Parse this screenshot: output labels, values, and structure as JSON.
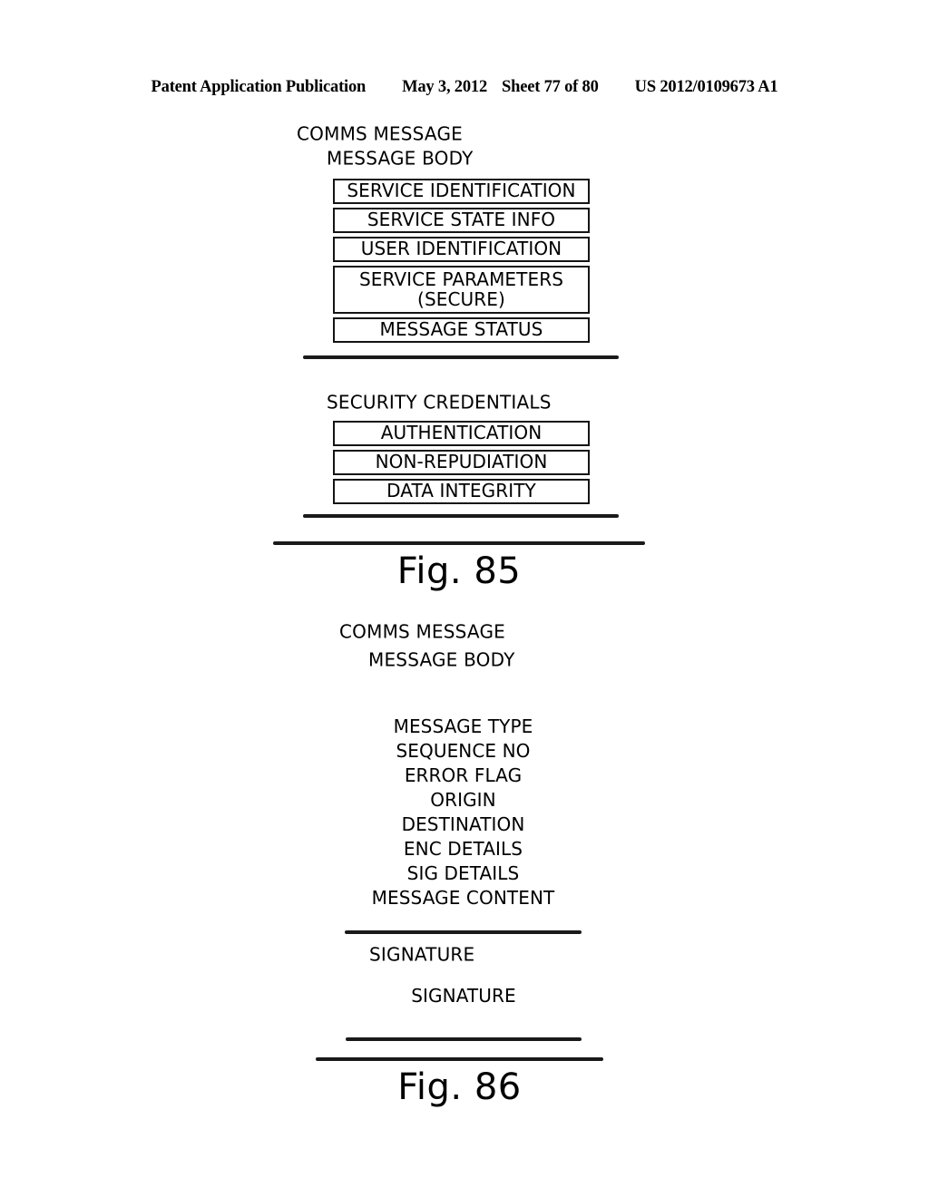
{
  "header": {
    "publication": "Patent Application Publication",
    "date": "May 3, 2012",
    "sheet": "Sheet 77 of 80",
    "doc_number": "US 2012/0109673 A1"
  },
  "figures": [
    {
      "caption": "Fig. 85",
      "outer_label": "COMMS MESSAGE",
      "groups": [
        {
          "label": "MESSAGE BODY",
          "style": "boxes",
          "items": [
            "SERVICE IDENTIFICATION",
            "SERVICE STATE INFO",
            "USER IDENTIFICATION",
            "SERVICE PARAMETERS\n(SECURE)",
            "MESSAGE STATUS"
          ]
        },
        {
          "label": "SECURITY CREDENTIALS",
          "style": "boxes",
          "items": [
            "AUTHENTICATION",
            "NON-REPUDIATION",
            "DATA INTEGRITY"
          ]
        }
      ]
    },
    {
      "caption": "Fig. 86",
      "outer_label": "COMMS MESSAGE",
      "groups": [
        {
          "label": "MESSAGE BODY",
          "style": "lines",
          "items": [
            "MESSAGE TYPE",
            "SEQUENCE NO",
            "ERROR FLAG",
            "ORIGIN",
            "DESTINATION",
            "ENC DETAILS",
            "SIG DETAILS",
            "MESSAGE CONTENT"
          ]
        },
        {
          "label": "SIGNATURE",
          "style": "lines",
          "items": [
            "SIGNATURE"
          ]
        }
      ]
    }
  ],
  "colors": {
    "ink": "#1a1a1a",
    "paper": "#ffffff"
  }
}
